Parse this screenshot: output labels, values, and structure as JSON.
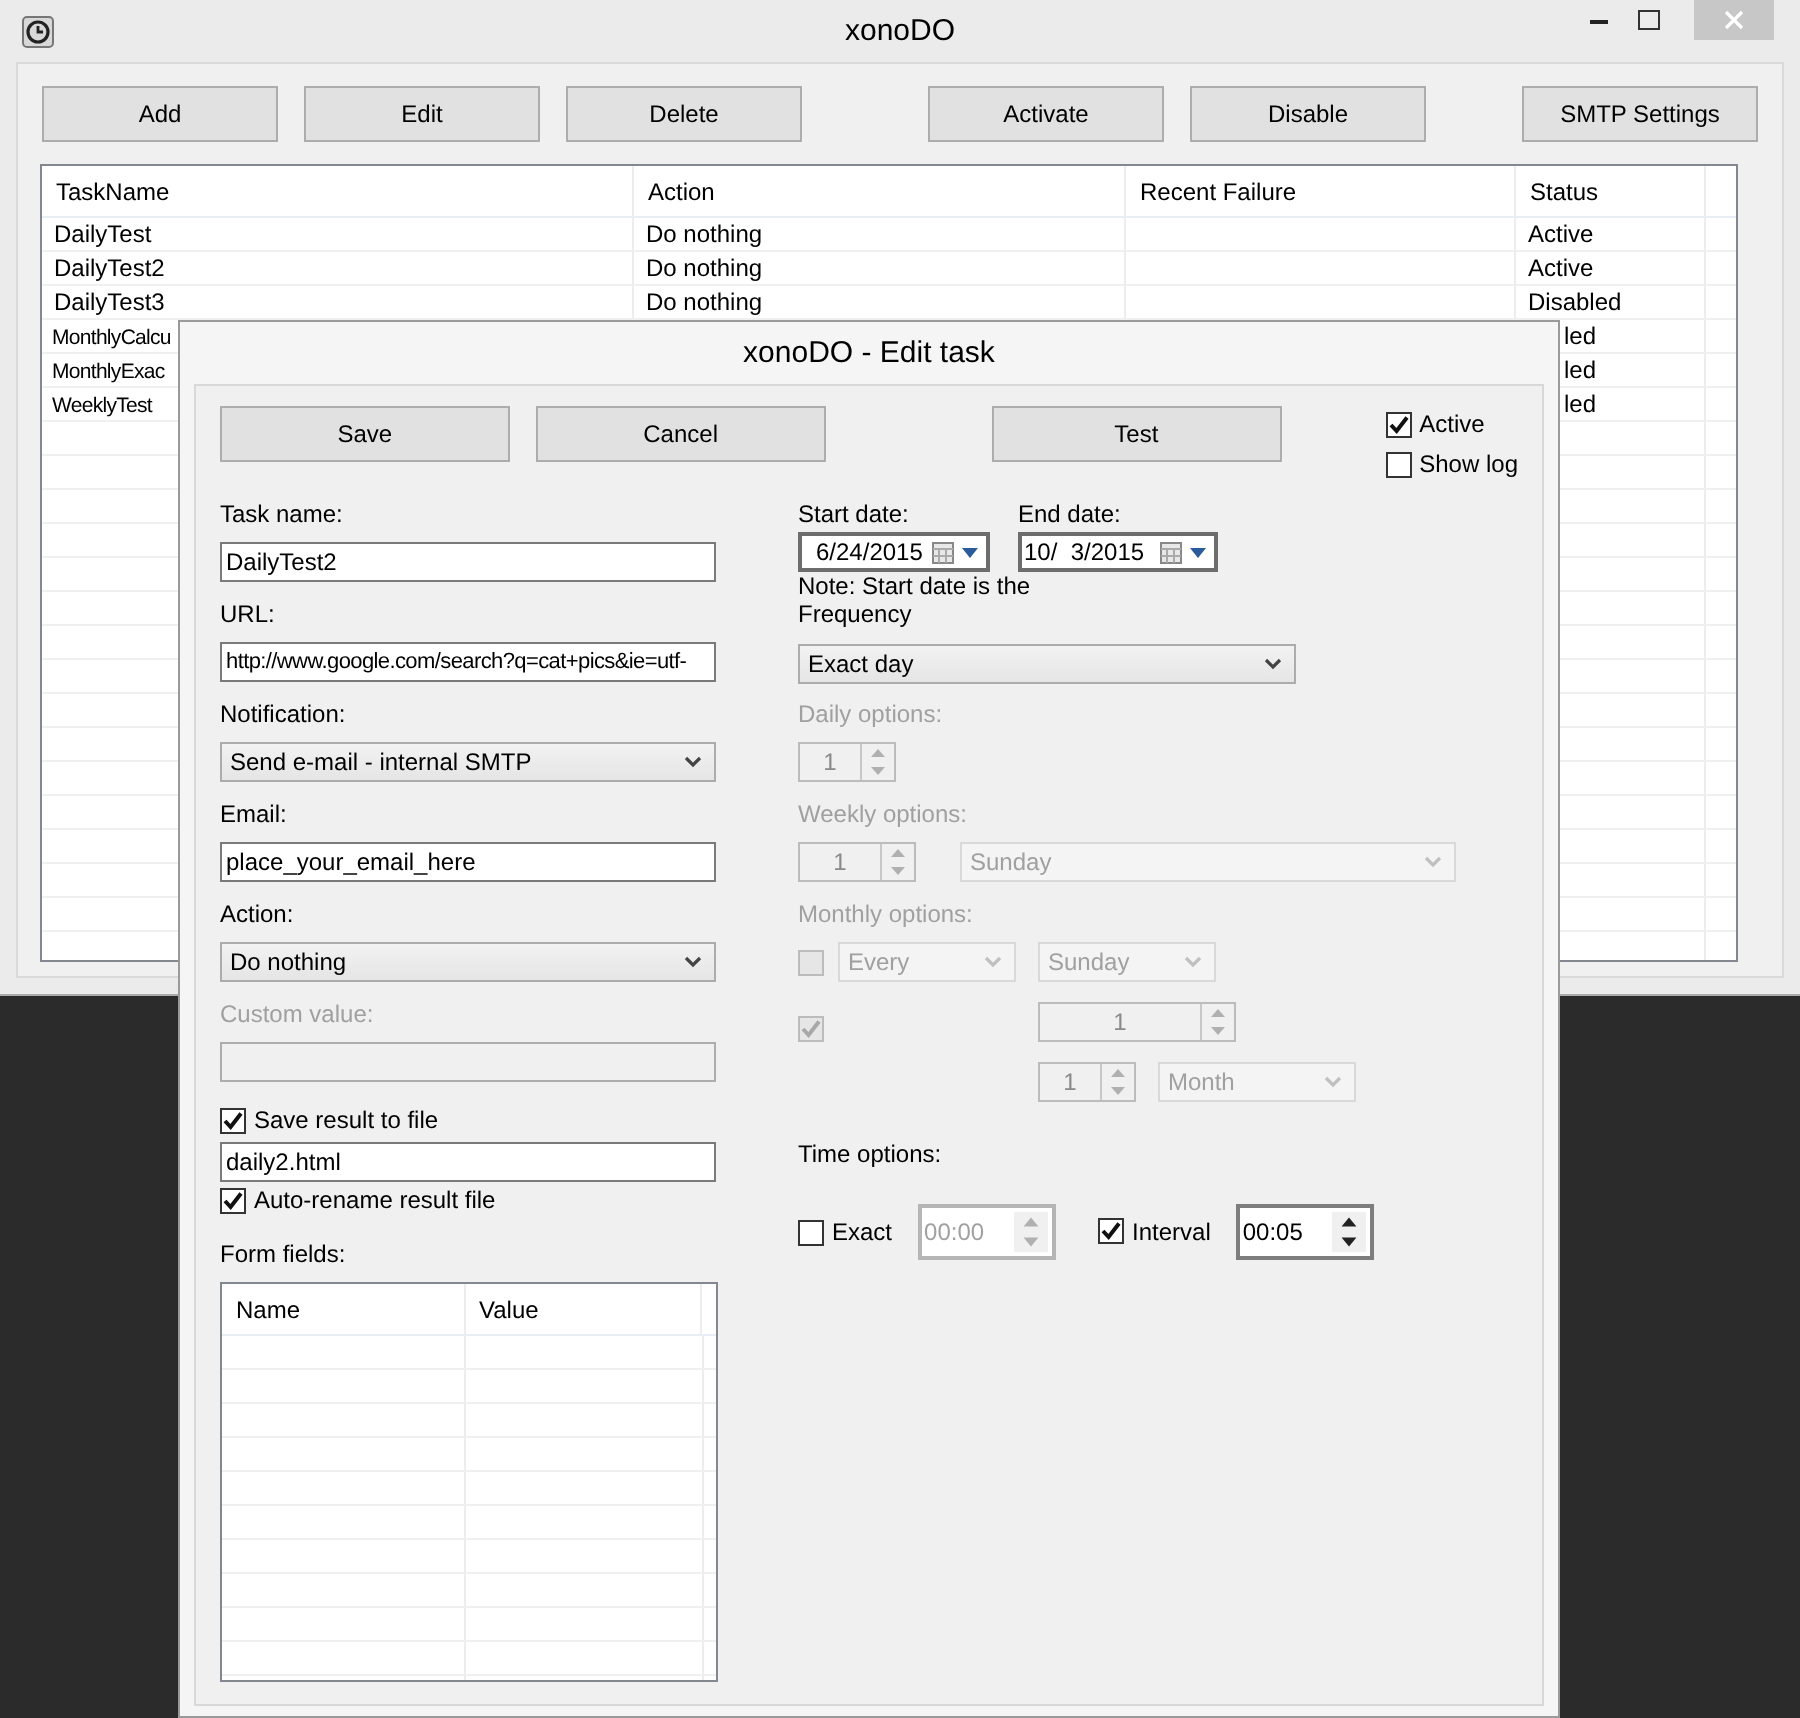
{
  "main_window": {
    "title": "xonoDO",
    "toolbar": [
      {
        "buttons": [
          "Add",
          "Edit",
          "Delete"
        ]
      },
      {
        "buttons": [
          "Activate",
          "Disable"
        ]
      },
      {
        "buttons": [
          "SMTP Settings"
        ]
      }
    ],
    "table": {
      "columns": [
        "TaskName",
        "Action",
        "Recent Failure",
        "Status"
      ],
      "rows": [
        {
          "task_name": "DailyTest",
          "action": "Do nothing",
          "status": "Active"
        },
        {
          "task_name": "DailyTest2",
          "action": "Do nothing",
          "status": "Active"
        },
        {
          "task_name": "DailyTest3",
          "action": "Do nothing",
          "status": "Disabled"
        },
        {
          "kind": "covered",
          "task_name": "MonthlyCalcu",
          "status": "led"
        },
        {
          "kind": "covered",
          "task_name": "MonthlyExac",
          "status": "led"
        },
        {
          "kind": "covered",
          "task_name": "WeeklyTest",
          "status": "led"
        }
      ]
    }
  },
  "dialog": {
    "title": "xonoDO - Edit task",
    "buttons": [
      "Save",
      "Cancel",
      "Test"
    ],
    "flags": [
      {
        "label": "Active",
        "checked": true
      },
      {
        "label": "Show log",
        "checked": false
      }
    ],
    "task_name": {
      "label": "Task name:",
      "value": "DailyTest2"
    },
    "url": {
      "label": "URL:",
      "value": "http://www.google.com/search?q=cat+pics&ie=utf-"
    },
    "notification": {
      "label": "Notification:",
      "value": "Send e-mail - internal SMTP"
    },
    "email": {
      "label": "Email:",
      "value": "place_your_email_here"
    },
    "action": {
      "label": "Action:",
      "value": "Do nothing"
    },
    "custom_value": {
      "label": "Custom value:",
      "disabled": true
    },
    "save_to_file": {
      "label": "Save result to file",
      "checked": true,
      "value": "daily2.html"
    },
    "auto_rename": {
      "label": "Auto-rename result file",
      "checked": true
    },
    "form_fields": {
      "label": "Form fields:",
      "columns": [
        "Name",
        "Value"
      ]
    },
    "start_date": {
      "label": "Start date:",
      "value": "6/24/2015"
    },
    "end_date": {
      "label": "End date:",
      "value": "10/  3/2015"
    },
    "note": "Note: Start date is the",
    "frequency": {
      "label": "Frequency",
      "value": "Exact day"
    },
    "daily_options": {
      "label": "Daily options:",
      "disabled": true,
      "count": "1"
    },
    "weekly_options": {
      "label": "Weekly options:",
      "disabled": true,
      "count": "1",
      "day": "Sunday"
    },
    "monthly_options": {
      "label": "Monthly options:",
      "disabled": true,
      "by_weekday": {
        "checked": false,
        "ordinal": "Every",
        "day": "Sunday"
      },
      "by_date": {
        "checked": true,
        "day": "1",
        "every": "1",
        "unit": "Month"
      }
    },
    "time_options": {
      "label": "Time options:",
      "exact": {
        "label": "Exact",
        "checked": false,
        "disabled": true,
        "value": "00:00"
      },
      "interval": {
        "label": "Interval",
        "checked": true,
        "disabled": false,
        "value": "00:05"
      }
    }
  }
}
